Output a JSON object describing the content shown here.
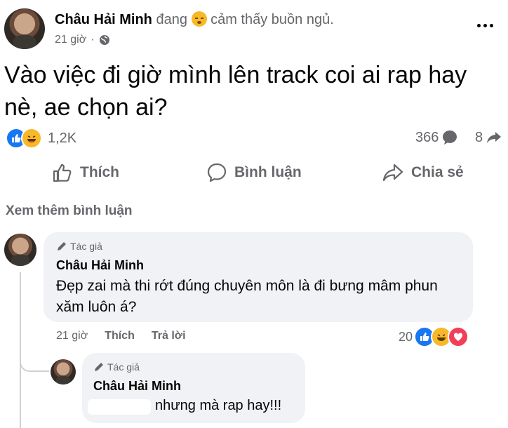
{
  "post": {
    "author": "Châu Hải Minh",
    "status_prefix": "đang",
    "status_feeling": "cảm thấy buồn ngủ.",
    "time": "21 giờ",
    "dot": "·",
    "content": "Vào việc đi giờ mình lên track coi ai rap hay nè, ae chọn ai?",
    "reaction_count": "1,2K",
    "comment_count": "366",
    "share_count": "8"
  },
  "actions": {
    "like": "Thích",
    "comment": "Bình luận",
    "share": "Chia sẻ"
  },
  "see_more_comments": "Xem thêm bình luận",
  "comments": [
    {
      "badge": "Tác giả",
      "author": "Châu Hải Minh",
      "text": "Đẹp zai mà thi rớt đúng chuyên môn là đi bưng mâm phun xăm luôn á?",
      "time": "21 giờ",
      "like": "Thích",
      "reply": "Trả lời",
      "reaction_count": "20"
    },
    {
      "badge": "Tác giả",
      "author": "Châu Hải Minh",
      "text": "nhưng mà rap hay!!!"
    }
  ],
  "colors": {
    "like_blue": "#1877f2",
    "haha_yellow": "#f7b928",
    "love_red": "#f33e58",
    "muted_gray": "#65676b",
    "bubble_bg": "#f0f2f5"
  },
  "icons": [
    "globe-icon",
    "more-icon",
    "like-reaction-icon",
    "haha-reaction-icon",
    "love-reaction-icon",
    "comment-icon",
    "share-icon",
    "thumbs-up-icon",
    "pencil-icon"
  ]
}
